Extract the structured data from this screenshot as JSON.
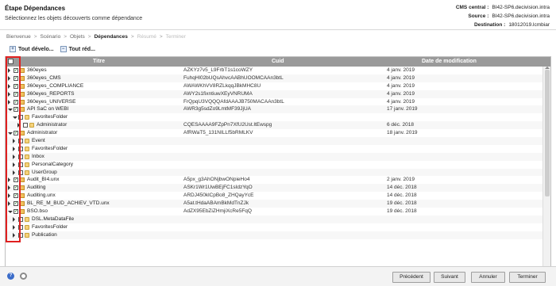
{
  "header": {
    "title": "Étape Dépendances",
    "subtitle": "Sélectionnez les objets découverts comme dépendance",
    "meta": [
      {
        "label": "CMS central :",
        "value": "BI42-SP6.decivision.intra"
      },
      {
        "label": "Source :",
        "value": "BI42-SP6.decivision.intra"
      },
      {
        "label": "Destination :",
        "value": "18012019.lcmbiar"
      }
    ]
  },
  "breadcrumb": {
    "items": [
      "Bienvenue",
      "Scénario",
      "Objets",
      "Dépendances",
      "Résumé",
      "Terminer"
    ],
    "sep": ">"
  },
  "toolbar": {
    "expand_label": "Tout dévelo...",
    "collapse_label": "Tout réd..."
  },
  "grid": {
    "columns": [
      "Titre",
      "Cuid",
      "Date de modification"
    ],
    "rows": [
      {
        "title": "360eyes",
        "cuid": "AZKYz7v5_L9FrbT1s1coWZY",
        "date": "4 janv. 2019",
        "type": "doc"
      },
      {
        "title": "360eyes_CMS",
        "cuid": "FuhqHl02bUQsAhvcAABhUOOMCAAn3btL",
        "date": "4 janv. 2019",
        "type": "doc"
      },
      {
        "title": "360eyes_COMPLIANCE",
        "cuid": "AWAWKhVV8RZLkqqJBkMHC8U",
        "date": "4 janv. 2019",
        "type": "doc"
      },
      {
        "title": "360eyes_REPORTS",
        "cuid": "AWY2s1fixntiuwXEyVNRUMA",
        "date": "4 janv. 2019",
        "type": "doc"
      },
      {
        "title": "360eyes_UNIVERSE",
        "cuid": "FrQpqU3VQQQAfdAAAJB750MACAAn3btL",
        "date": "4 janv. 2019",
        "type": "doc"
      },
      {
        "title": "API SaC on WEBI",
        "cuid": "AWR3g5sdZo9LmtMF39JjUA",
        "date": "17 janv. 2019",
        "type": "doc"
      },
      {
        "title": "FavoritesFolder",
        "cuid": "",
        "date": "",
        "type": "fold"
      },
      {
        "title": "Administrator",
        "cuid": "CQESAAAA9FZpPn7XfU2Ust.ltEwspg",
        "date": "6 déc. 2018",
        "type": "fold"
      },
      {
        "title": "Administrator",
        "cuid": "AfRWaT5_131NILLf5bRMLKV",
        "date": "18 janv. 2019",
        "type": "doc"
      },
      {
        "title": "Event",
        "cuid": "",
        "date": "",
        "type": "fold"
      },
      {
        "title": "FavoritesFolder",
        "cuid": "",
        "date": "",
        "type": "fold"
      },
      {
        "title": "Inbox",
        "cuid": "",
        "date": "",
        "type": "fold"
      },
      {
        "title": "PersonalCategory",
        "cuid": "",
        "date": "",
        "type": "fold"
      },
      {
        "title": "UserGroup",
        "cuid": "",
        "date": "",
        "type": "fold"
      },
      {
        "title": "Audit_BI4.unx",
        "cuid": "A5px_g3AhONjbwONpieHo4",
        "date": "2 janv. 2019",
        "type": "doc"
      },
      {
        "title": "Auditing",
        "cuid": "ASKr1Wr1UwBEjFC1sIdzYqO",
        "date": "14 déc. 2018",
        "type": "doc"
      },
      {
        "title": "Auditing.unx",
        "cuid": "ARDJ450klCpBo8_ZHQayYcE",
        "date": "14 déc. 2018",
        "type": "doc"
      },
      {
        "title": "BL_RE_M_BUD_ACHIEV_VTD.unx",
        "cuid": "A5at.tHdaABAmBkMdTnZJk",
        "date": "19 déc. 2018",
        "type": "doc"
      },
      {
        "title": "BSO.bso",
        "cuid": "AdZX95EbZiZHmjiXcRe5FqQ",
        "date": "19 déc. 2018",
        "type": "doc"
      },
      {
        "title": "DSL.MetaDataFile",
        "cuid": "",
        "date": "",
        "type": "fold"
      },
      {
        "title": "FavoritesFolder",
        "cuid": "",
        "date": "",
        "type": "fold"
      },
      {
        "title": "Publication",
        "cuid": "",
        "date": "",
        "type": "fold"
      }
    ]
  },
  "footer": {
    "prev_label": "Précédent",
    "next_label": "Suivant",
    "cancel_label": "Annuler",
    "finish_label": "Terminer"
  },
  "colors": {
    "highlight": "#e02020",
    "header_bg": "#9a9a9a"
  }
}
